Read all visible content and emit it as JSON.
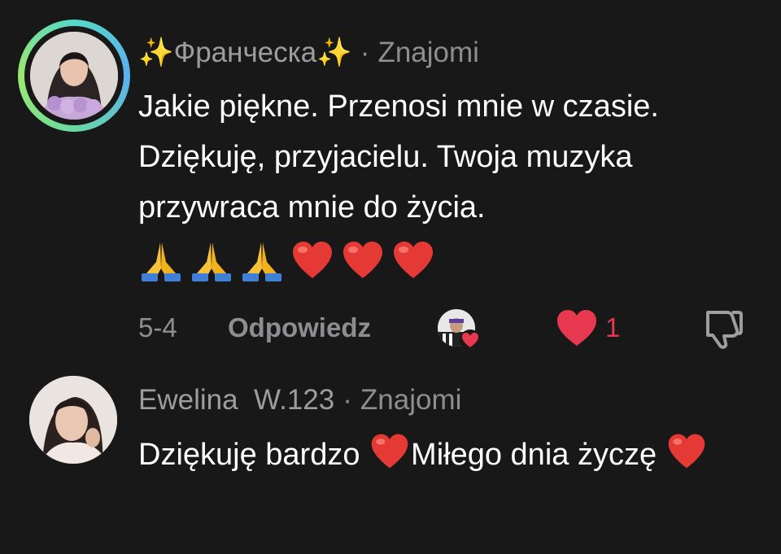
{
  "comments": [
    {
      "author": "✨Франческа✨",
      "separator": "·",
      "relation": "Znajomi",
      "text": "Jakie piękne. Przenosi mnie w czasie. Dziękuję, przyjacielu. Twoja muzyka przywraca mnie do życia.",
      "emojis": [
        "folded-hands",
        "folded-hands",
        "folded-hands",
        "red-heart",
        "red-heart",
        "red-heart"
      ],
      "date": "5-4",
      "reply_label": "Odpowiedz",
      "like_count": "1",
      "liked": true,
      "creator_liked": true
    },
    {
      "author": "Ewelina  W.123",
      "separator": "·",
      "relation": "Znajomi",
      "text_part1": "Dziękuję bardzo ",
      "text_part2": "Miłego dnia życzę "
    }
  ],
  "colors": {
    "background": "#181818",
    "text": "#ffffff",
    "muted": "#8e8e90",
    "like": "#e8384f",
    "ring_start": "#56d8c8",
    "ring_end": "#9be870"
  }
}
